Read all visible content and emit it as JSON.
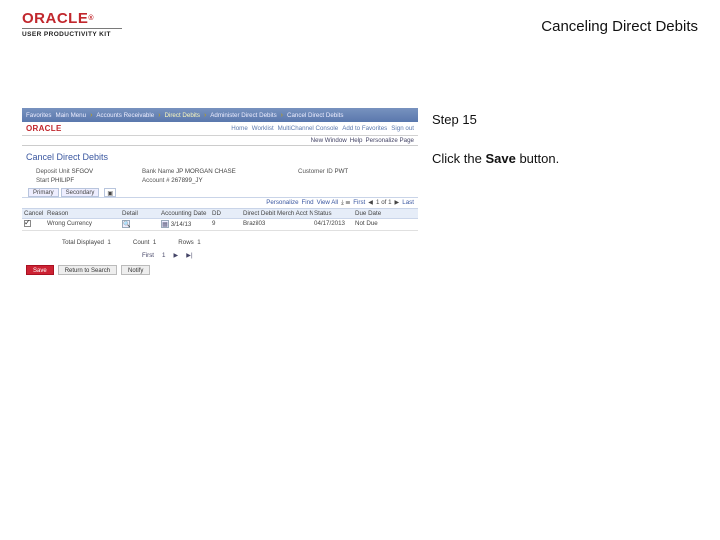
{
  "brand": {
    "logo": "ORACLE",
    "tm": "®",
    "kit": "USER PRODUCTIVITY KIT"
  },
  "doc_title": "Canceling Direct Debits",
  "instruction": {
    "step_label": "Step 15",
    "prefix": "Click the ",
    "bold": "Save ",
    "suffix": "button."
  },
  "app": {
    "nav": {
      "i0": "Favorites",
      "i1": "Main Menu",
      "i2": "Accounts Receivable",
      "i3": "Direct Debits",
      "i4": "Administer Direct Debits",
      "i5": "Cancel Direct Debits",
      "arrow": "›"
    },
    "logo": "ORACLE",
    "tabs": {
      "home": "Home",
      "worklist": "Worklist",
      "mc": "MultiChannel Console",
      "atf": "Add to Favorites",
      "signout": "Sign out"
    },
    "userline": {
      "nw": "New Window",
      "help": "Help",
      "pp": "Personalize Page"
    },
    "page_title": "Cancel Direct Debits",
    "meta": {
      "du_lbl": "Deposit Unit",
      "du": "SFGOV",
      "bank_lbl": "Bank Name",
      "bank": "JP MORGAN CHASE",
      "cust_lbl": "Customer ID",
      "cust": "PWT",
      "start_lbl": "Start",
      "start": "PHILIPF",
      "acct_lbl": "Account #",
      "acct": "267899_JY"
    },
    "subtabs": {
      "a": "Primary",
      "b": "Secondary",
      "expand": "▣"
    },
    "tbar": {
      "p": "Personalize",
      "f": "Find",
      "v": "View All",
      "first": "First",
      "range": "1 of 1",
      "last": "Last",
      "l": "◀",
      "r": "▶",
      "icons": "⤓ ☰"
    },
    "thead": {
      "c0": "Cancel",
      "c1": "Reason",
      "c2": "Detail",
      "c3": "Accounting Date",
      "c4": "DD",
      "c5": "Direct Debit Merch Acct Name",
      "c6": "Status",
      "c7": "Due Date"
    },
    "row": {
      "chk": true,
      "reason": "Wrong Currency",
      "detail": "🔍",
      "adate": "3/14/13",
      "dd": "9",
      "mname": "Brazil03",
      "status": "04/17/2013",
      "duedate": "Not Due"
    },
    "summary": {
      "td_lbl": "Total Displayed",
      "td": "1",
      "cnt_lbl": "Count",
      "cnt": "1",
      "rows_lbl": "Rows",
      "rows": "1"
    },
    "pager": {
      "first": "First",
      "one": "1",
      "r": "▶",
      "last": "▶|"
    },
    "actions": {
      "save": "Save",
      "rts": "Return to Search",
      "notify": "Notify"
    }
  }
}
